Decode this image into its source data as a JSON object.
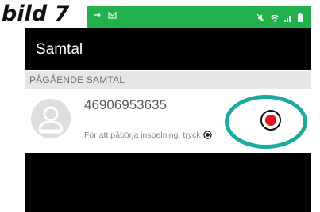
{
  "caption": "bild 7",
  "statusbar": {
    "color": "#22b14c",
    "left_icons": [
      "arrow-icon",
      "gmail-icon"
    ],
    "right_icons": [
      "mute-icon",
      "wifi-icon",
      "signal-icon",
      "battery-icon"
    ]
  },
  "appbar": {
    "title": "Samtal"
  },
  "section": {
    "label": "PÅGÅENDE SAMTAL"
  },
  "call": {
    "number": "46906953635",
    "hint": "För att påbörja inspelning, tryck",
    "record_color": "#e8131c"
  },
  "annotation": {
    "color": "#1aaaa0"
  }
}
